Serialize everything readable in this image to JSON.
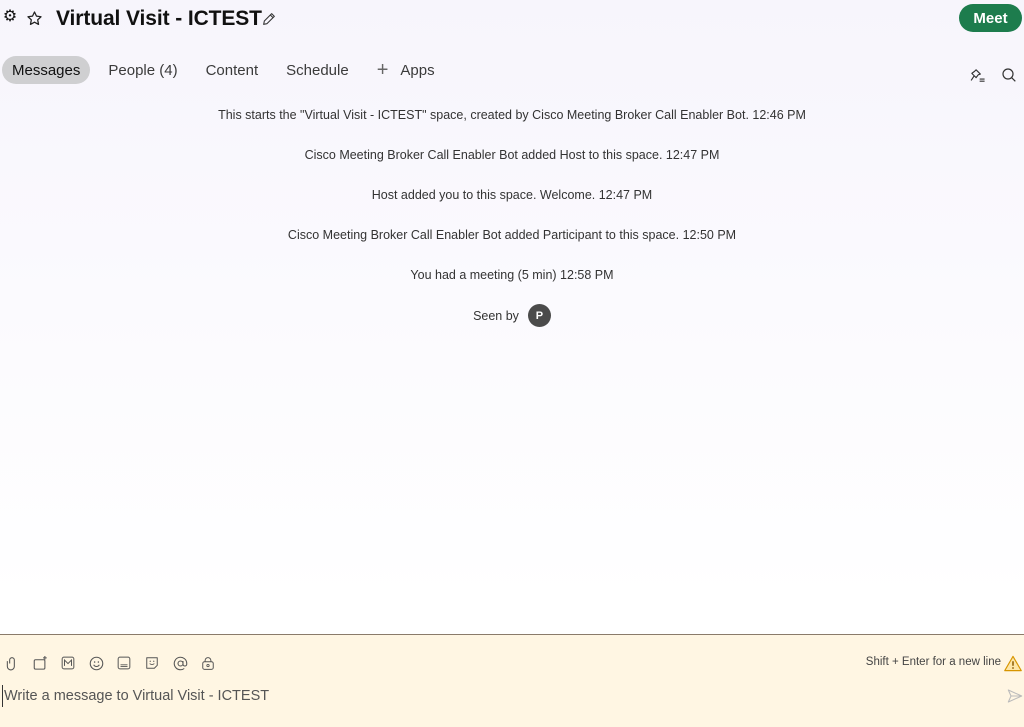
{
  "header": {
    "title": "Virtual Visit - ICTEST",
    "meet_label": "Meet",
    "settings_icon": "gear-icon",
    "favorite_icon": "star-icon",
    "edit_icon": "pencil-icon"
  },
  "tabs": [
    {
      "label": "Messages",
      "active": true
    },
    {
      "label": "People (4)",
      "active": false
    },
    {
      "label": "Content",
      "active": false
    },
    {
      "label": "Schedule",
      "active": false
    },
    {
      "label": "Apps",
      "active": false,
      "icon": "plus-icon"
    }
  ],
  "tab_tools": {
    "pin_icon": "pinned-messages-icon",
    "search_icon": "search-icon"
  },
  "activity": [
    "This starts the \"Virtual Visit - ICTEST\" space, created by Cisco Meeting Broker Call Enabler Bot. 12:46 PM",
    "Cisco Meeting Broker Call Enabler Bot added Host to this space. 12:47 PM",
    "Host added you to this space. Welcome. 12:47 PM",
    "Cisco Meeting Broker Call Enabler Bot added Participant to this space. 12:50 PM",
    "You had a meeting (5 min) 12:58 PM"
  ],
  "seen": {
    "label": "Seen by",
    "avatar_initial": "P"
  },
  "composer": {
    "placeholder": "Write a message to Virtual Visit - ICTEST",
    "value": "",
    "hint": "Shift + Enter for a new line",
    "tools": [
      "attach-icon",
      "share-screenshot-icon",
      "markdown-icon",
      "emoji-icon",
      "gif-icon",
      "sticker-icon",
      "mention-icon",
      "secure-icon"
    ]
  },
  "colors": {
    "meet_button": "#1d7c4d",
    "composer_bg": "#fff6e3",
    "warning": "#d79500"
  }
}
